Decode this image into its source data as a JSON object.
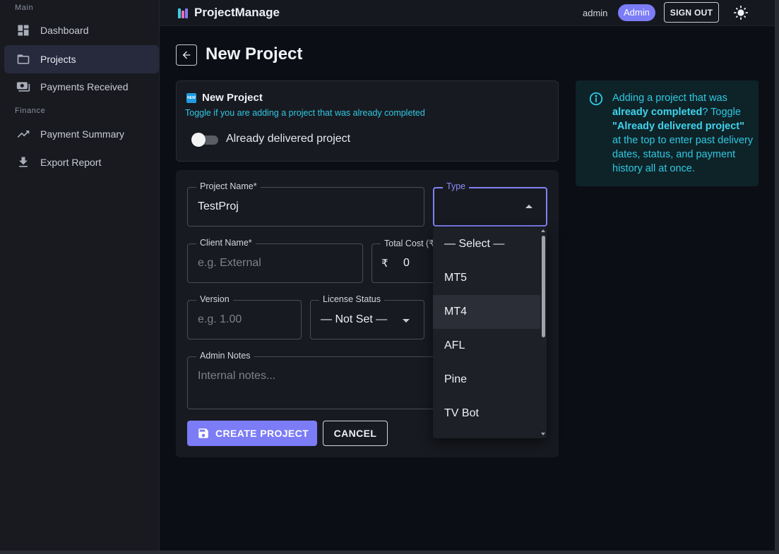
{
  "sidebar": {
    "section_main": "Main",
    "section_finance": "Finance",
    "items": [
      {
        "label": "Dashboard",
        "icon": "dashboard-icon"
      },
      {
        "label": "Projects",
        "icon": "folder-icon"
      },
      {
        "label": "Payments Received",
        "icon": "payments-icon"
      },
      {
        "label": "Payment Summary",
        "icon": "trending-up-icon"
      },
      {
        "label": "Export Report",
        "icon": "download-icon"
      }
    ]
  },
  "topbar": {
    "brand": "ProjectManage",
    "user": "admin",
    "role": "Admin",
    "signout_label": "SIGN OUT"
  },
  "page": {
    "title": "New Project"
  },
  "new_card": {
    "badge": "NEW",
    "title": "New Project",
    "subtitle": "Toggle if you are adding a project that was already completed",
    "toggle_label": "Already delivered project"
  },
  "info": {
    "t1": "Adding a project that was ",
    "b1": "already completed",
    "t2": "? Toggle ",
    "b2": "\"Already delivered project\"",
    "t3": " at the top to enter past delivery dates, status, and payment history all at once."
  },
  "form": {
    "project_name_label": "Project Name*",
    "project_name_value": "TestProj",
    "type_label": "Type",
    "client_name_label": "Client Name*",
    "client_name_placeholder": "e.g. External",
    "total_cost_label": "Total Cost (₹",
    "currency_symbol": "₹",
    "total_cost_value": "0",
    "version_label": "Version",
    "version_placeholder": "e.g. 1.00",
    "license_label": "License Status",
    "license_value": "— Not Set —",
    "notes_label": "Admin Notes",
    "notes_placeholder": "Internal notes...",
    "create_label": "CREATE PROJECT",
    "cancel_label": "CANCEL"
  },
  "type_menu": {
    "options": [
      "— Select —",
      "MT5",
      "MT4",
      "AFL",
      "Pine",
      "TV Bot"
    ],
    "hovered": "MT4"
  },
  "colors": {
    "accent": "#7b7cf6",
    "info": "#2fc8e2",
    "background": "#0b0e14"
  }
}
